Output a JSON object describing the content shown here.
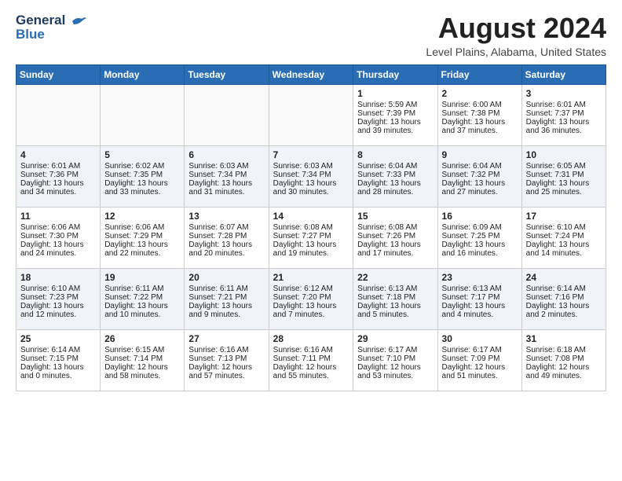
{
  "header": {
    "logo_line1": "General",
    "logo_line2": "Blue",
    "month": "August 2024",
    "location": "Level Plains, Alabama, United States"
  },
  "weekdays": [
    "Sunday",
    "Monday",
    "Tuesday",
    "Wednesday",
    "Thursday",
    "Friday",
    "Saturday"
  ],
  "weeks": [
    [
      {
        "day": "",
        "content": ""
      },
      {
        "day": "",
        "content": ""
      },
      {
        "day": "",
        "content": ""
      },
      {
        "day": "",
        "content": ""
      },
      {
        "day": "1",
        "content": "Sunrise: 5:59 AM\nSunset: 7:39 PM\nDaylight: 13 hours\nand 39 minutes."
      },
      {
        "day": "2",
        "content": "Sunrise: 6:00 AM\nSunset: 7:38 PM\nDaylight: 13 hours\nand 37 minutes."
      },
      {
        "day": "3",
        "content": "Sunrise: 6:01 AM\nSunset: 7:37 PM\nDaylight: 13 hours\nand 36 minutes."
      }
    ],
    [
      {
        "day": "4",
        "content": "Sunrise: 6:01 AM\nSunset: 7:36 PM\nDaylight: 13 hours\nand 34 minutes."
      },
      {
        "day": "5",
        "content": "Sunrise: 6:02 AM\nSunset: 7:35 PM\nDaylight: 13 hours\nand 33 minutes."
      },
      {
        "day": "6",
        "content": "Sunrise: 6:03 AM\nSunset: 7:34 PM\nDaylight: 13 hours\nand 31 minutes."
      },
      {
        "day": "7",
        "content": "Sunrise: 6:03 AM\nSunset: 7:34 PM\nDaylight: 13 hours\nand 30 minutes."
      },
      {
        "day": "8",
        "content": "Sunrise: 6:04 AM\nSunset: 7:33 PM\nDaylight: 13 hours\nand 28 minutes."
      },
      {
        "day": "9",
        "content": "Sunrise: 6:04 AM\nSunset: 7:32 PM\nDaylight: 13 hours\nand 27 minutes."
      },
      {
        "day": "10",
        "content": "Sunrise: 6:05 AM\nSunset: 7:31 PM\nDaylight: 13 hours\nand 25 minutes."
      }
    ],
    [
      {
        "day": "11",
        "content": "Sunrise: 6:06 AM\nSunset: 7:30 PM\nDaylight: 13 hours\nand 24 minutes."
      },
      {
        "day": "12",
        "content": "Sunrise: 6:06 AM\nSunset: 7:29 PM\nDaylight: 13 hours\nand 22 minutes."
      },
      {
        "day": "13",
        "content": "Sunrise: 6:07 AM\nSunset: 7:28 PM\nDaylight: 13 hours\nand 20 minutes."
      },
      {
        "day": "14",
        "content": "Sunrise: 6:08 AM\nSunset: 7:27 PM\nDaylight: 13 hours\nand 19 minutes."
      },
      {
        "day": "15",
        "content": "Sunrise: 6:08 AM\nSunset: 7:26 PM\nDaylight: 13 hours\nand 17 minutes."
      },
      {
        "day": "16",
        "content": "Sunrise: 6:09 AM\nSunset: 7:25 PM\nDaylight: 13 hours\nand 16 minutes."
      },
      {
        "day": "17",
        "content": "Sunrise: 6:10 AM\nSunset: 7:24 PM\nDaylight: 13 hours\nand 14 minutes."
      }
    ],
    [
      {
        "day": "18",
        "content": "Sunrise: 6:10 AM\nSunset: 7:23 PM\nDaylight: 13 hours\nand 12 minutes."
      },
      {
        "day": "19",
        "content": "Sunrise: 6:11 AM\nSunset: 7:22 PM\nDaylight: 13 hours\nand 10 minutes."
      },
      {
        "day": "20",
        "content": "Sunrise: 6:11 AM\nSunset: 7:21 PM\nDaylight: 13 hours\nand 9 minutes."
      },
      {
        "day": "21",
        "content": "Sunrise: 6:12 AM\nSunset: 7:20 PM\nDaylight: 13 hours\nand 7 minutes."
      },
      {
        "day": "22",
        "content": "Sunrise: 6:13 AM\nSunset: 7:18 PM\nDaylight: 13 hours\nand 5 minutes."
      },
      {
        "day": "23",
        "content": "Sunrise: 6:13 AM\nSunset: 7:17 PM\nDaylight: 13 hours\nand 4 minutes."
      },
      {
        "day": "24",
        "content": "Sunrise: 6:14 AM\nSunset: 7:16 PM\nDaylight: 13 hours\nand 2 minutes."
      }
    ],
    [
      {
        "day": "25",
        "content": "Sunrise: 6:14 AM\nSunset: 7:15 PM\nDaylight: 13 hours\nand 0 minutes."
      },
      {
        "day": "26",
        "content": "Sunrise: 6:15 AM\nSunset: 7:14 PM\nDaylight: 12 hours\nand 58 minutes."
      },
      {
        "day": "27",
        "content": "Sunrise: 6:16 AM\nSunset: 7:13 PM\nDaylight: 12 hours\nand 57 minutes."
      },
      {
        "day": "28",
        "content": "Sunrise: 6:16 AM\nSunset: 7:11 PM\nDaylight: 12 hours\nand 55 minutes."
      },
      {
        "day": "29",
        "content": "Sunrise: 6:17 AM\nSunset: 7:10 PM\nDaylight: 12 hours\nand 53 minutes."
      },
      {
        "day": "30",
        "content": "Sunrise: 6:17 AM\nSunset: 7:09 PM\nDaylight: 12 hours\nand 51 minutes."
      },
      {
        "day": "31",
        "content": "Sunrise: 6:18 AM\nSunset: 7:08 PM\nDaylight: 12 hours\nand 49 minutes."
      }
    ]
  ]
}
